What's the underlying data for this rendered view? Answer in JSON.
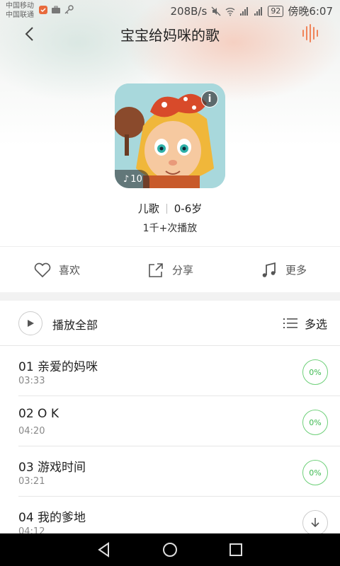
{
  "status_bar": {
    "carrier_1": "中国移动",
    "carrier_2": "中国联通",
    "speed": "208B/s",
    "battery": "92",
    "time": "傍晚6:07"
  },
  "header": {
    "title": "宝宝给妈咪的歌"
  },
  "album": {
    "track_count": "10",
    "category": "儿歌",
    "age_range": "0-6岁",
    "plays": "1千+次播放"
  },
  "actions": {
    "like": "喜欢",
    "share": "分享",
    "more": "更多"
  },
  "list_header": {
    "play_all": "播放全部",
    "multi_select": "多选"
  },
  "tracks": [
    {
      "title": "01 亲爱的妈咪",
      "duration": "03:33",
      "status": "0%"
    },
    {
      "title": "02 O K",
      "duration": "04:20",
      "status": "0%"
    },
    {
      "title": "03 游戏时间",
      "duration": "03:21",
      "status": "0%"
    },
    {
      "title": "04 我的爹地",
      "duration": "04:12",
      "status": "download"
    }
  ],
  "colors": {
    "accent_orange": "#f0845a",
    "progress_green": "#3cb94f"
  }
}
